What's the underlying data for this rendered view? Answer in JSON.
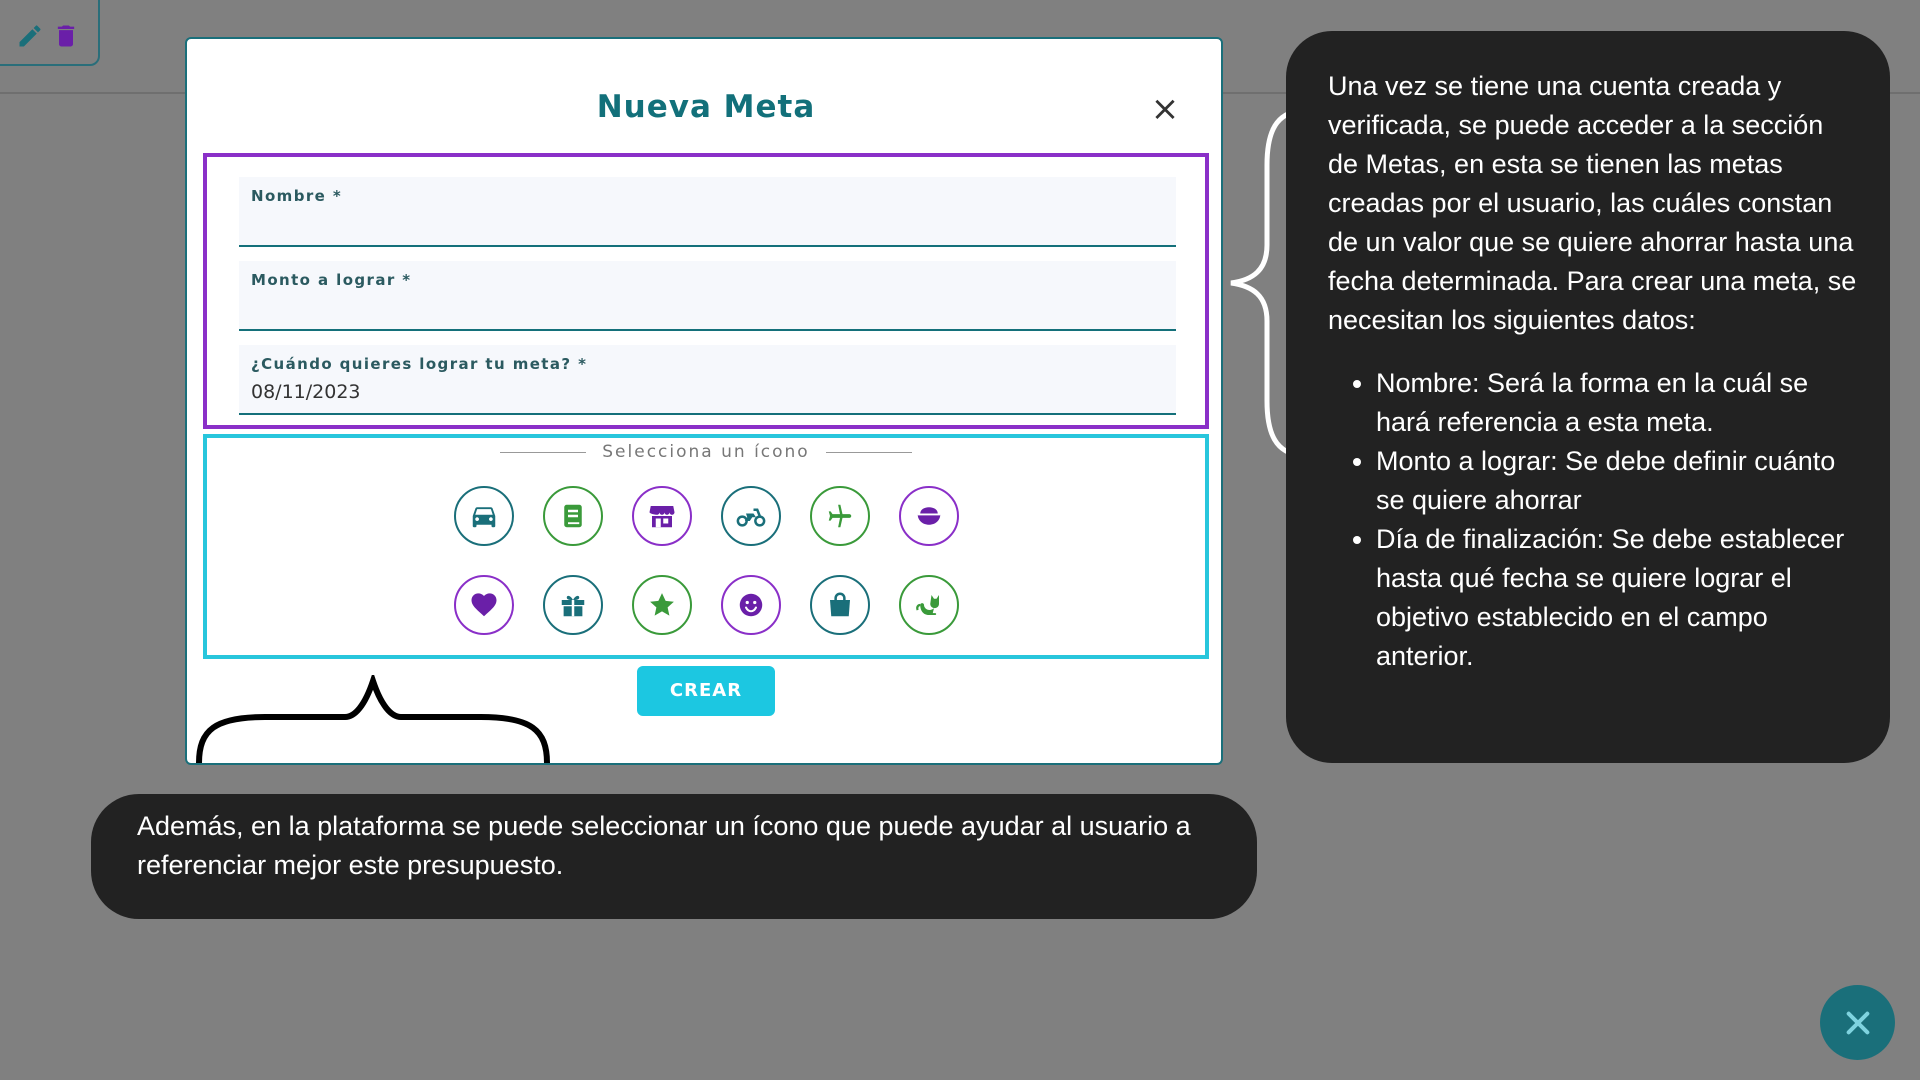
{
  "modal": {
    "title": "Nueva Meta",
    "close_label": "×",
    "fields": [
      {
        "label": "Nombre *",
        "value": ""
      },
      {
        "label": "Monto a lograr *",
        "value": ""
      },
      {
        "label": "¿Cuándo quieres lograr tu meta? *",
        "value": "08/11/2023"
      }
    ],
    "icons_title": "Selecciona un ícono",
    "icons": [
      {
        "name": "car-icon",
        "color": "#1a6f7a"
      },
      {
        "name": "book-icon",
        "color": "#3a9a3a"
      },
      {
        "name": "store-icon",
        "color": "#8a2fc8"
      },
      {
        "name": "motorcycle-icon",
        "color": "#1a6f7a"
      },
      {
        "name": "plane-icon",
        "color": "#3a9a3a"
      },
      {
        "name": "food-bowl-icon",
        "color": "#8a2fc8"
      },
      {
        "name": "heart-icon",
        "color": "#8a2fc8"
      },
      {
        "name": "gift-icon",
        "color": "#1a6f7a"
      },
      {
        "name": "star-icon",
        "color": "#3a9a3a"
      },
      {
        "name": "smiley-icon",
        "color": "#8a2fc8"
      },
      {
        "name": "shopping-bag-icon",
        "color": "#1a6f7a"
      },
      {
        "name": "cat-icon",
        "color": "#3a9a3a"
      }
    ],
    "create_label": "CREAR"
  },
  "callout_right": {
    "paragraph": "Una vez se tiene una cuenta creada y verificada, se puede acceder a la sección de Metas, en esta se tienen las metas creadas por el usuario, las cuáles constan de un valor que se quiere ahorrar hasta una fecha determinada. Para crear una meta, se necesitan los siguientes datos:",
    "bullets": [
      "Nombre: Será la forma en la cuál se hará referencia a esta meta.",
      "Monto a lograr: Se debe definir cuánto se quiere ahorrar",
      "Día de finalización: Se debe establecer hasta qué fecha se quiere lograr el objetivo establecido en el campo anterior."
    ]
  },
  "callout_bottom": {
    "text": "Además, en la plataforma se puede seleccionar un ícono que puede ayudar al usuario a referenciar mejor este presupuesto."
  },
  "colors": {
    "teal": "#1a6f7a",
    "purple": "#8a2fc8",
    "cyan": "#1cc7e1",
    "green": "#3a9a3a",
    "callout_bg": "#222222"
  }
}
